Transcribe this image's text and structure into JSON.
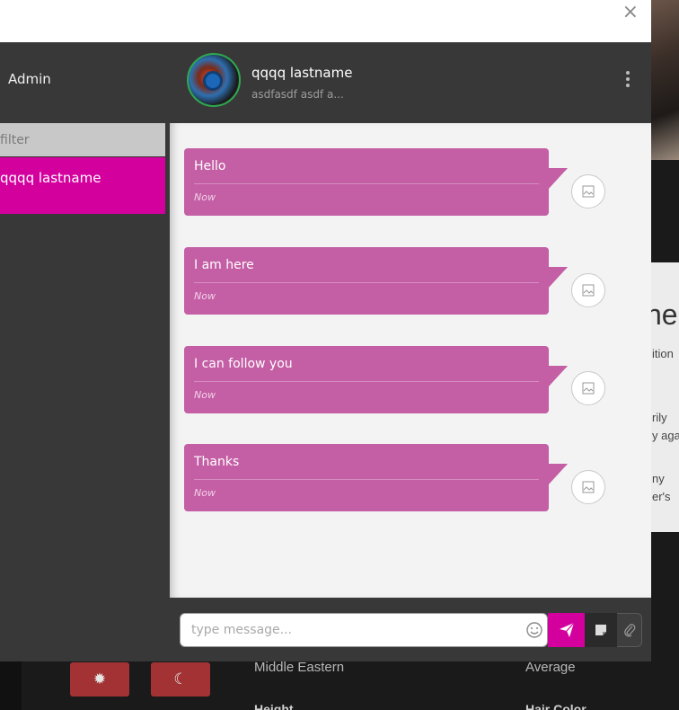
{
  "modal": {
    "close_symbol": "×",
    "admin_label": "Admin"
  },
  "contact": {
    "name": "qqqq lastname",
    "status": "asdfasdf asdf a..."
  },
  "sidebar": {
    "filter_placeholder": "filter",
    "items": [
      {
        "label": "qqqq lastname"
      }
    ]
  },
  "messages": [
    {
      "text": "Hello",
      "time": "Now"
    },
    {
      "text": "I am here",
      "time": "Now"
    },
    {
      "text": "I can follow you",
      "time": "Now"
    },
    {
      "text": "Thanks",
      "time": "Now"
    }
  ],
  "composer": {
    "placeholder": "type message..."
  },
  "icons": {
    "close": "close-icon",
    "menu": "kebab-menu-icon",
    "emoji": "smiley-icon",
    "send": "paper-plane-icon",
    "sticker": "sticky-note-icon",
    "attach": "paperclip-icon",
    "broken_image": "broken-image-icon",
    "sun": "sun-icon",
    "moon": "moon-icon"
  },
  "colors": {
    "accent": "#d4009e",
    "bubble": "#c45ea5",
    "panel": "#383838",
    "online_ring": "#2fa84f",
    "bg_button": "#a23234"
  },
  "background": {
    "card_heading": "neo",
    "card_lines": [
      "ition",
      "rily",
      "y aga",
      "ny",
      "er's"
    ],
    "ethnicity": "Middle Eastern",
    "body_type": "Average",
    "height_label": "Height",
    "hair_color_label": "Hair Color"
  }
}
